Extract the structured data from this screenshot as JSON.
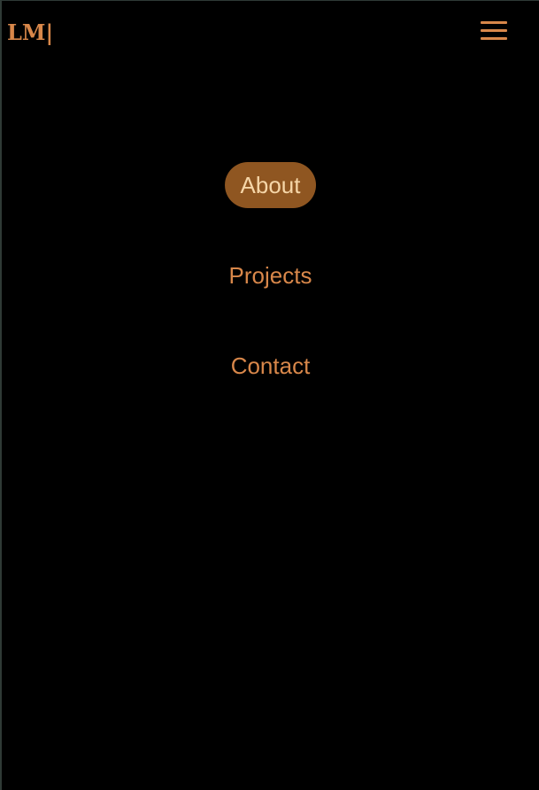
{
  "header": {
    "logo_text": "LM|"
  },
  "nav": {
    "menu_icon": "hamburger-menu-icon",
    "items": [
      {
        "label": "About",
        "active": true
      },
      {
        "label": "Projects",
        "active": false
      },
      {
        "label": "Contact",
        "active": false
      }
    ]
  },
  "colors": {
    "background": "#000000",
    "accent": "#d8874a",
    "active_pill": "#8f5621",
    "active_text": "#f6d6a8"
  }
}
